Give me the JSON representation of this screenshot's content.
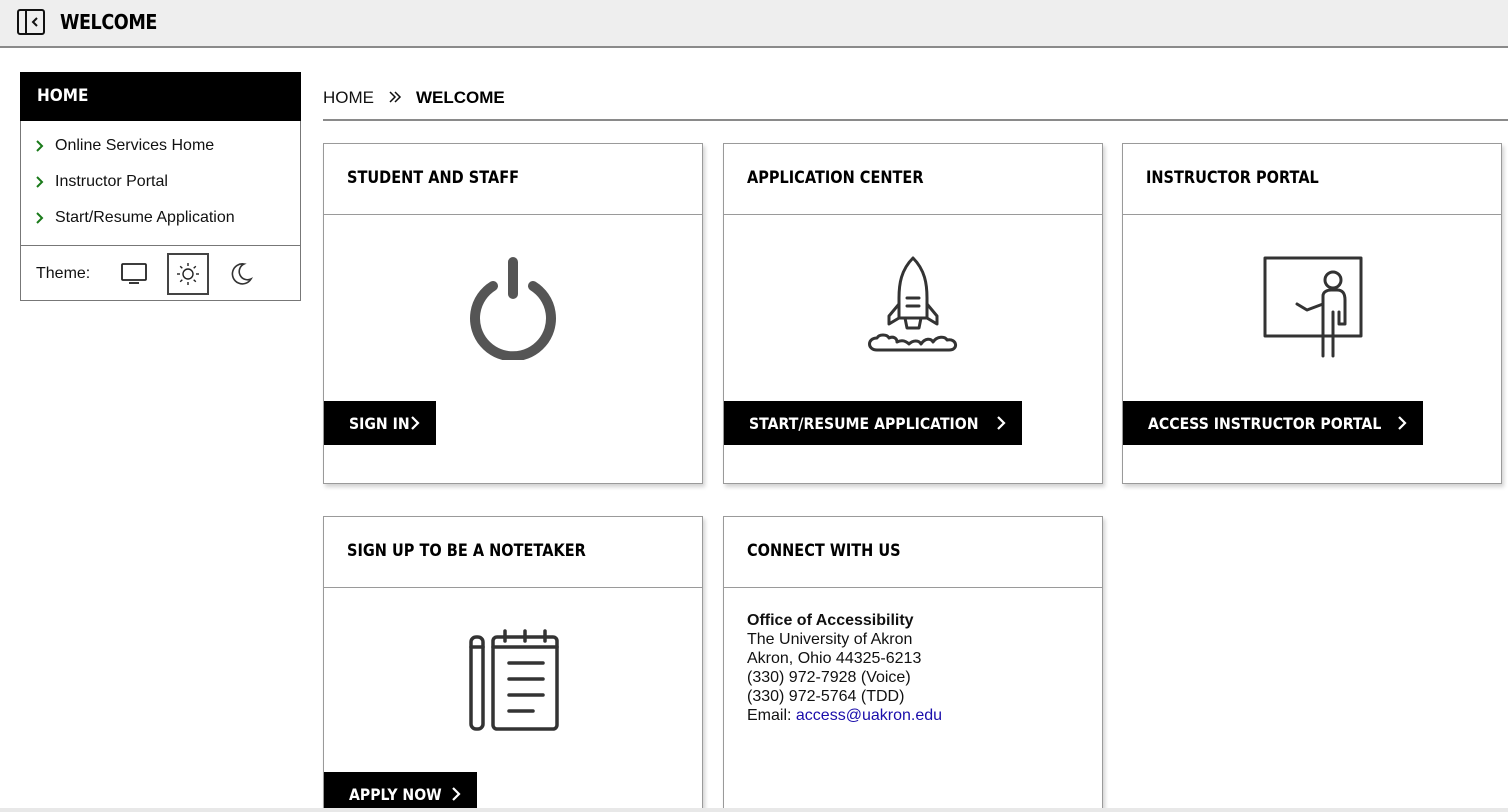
{
  "header": {
    "title": "WELCOME",
    "toggle_icon": "sidebar-collapse-icon"
  },
  "sidebar": {
    "heading": "HOME",
    "items": [
      {
        "label": "Online Services Home",
        "icon": "chevron-right-icon"
      },
      {
        "label": "Instructor Portal",
        "icon": "chevron-right-icon"
      },
      {
        "label": "Start/Resume Application",
        "icon": "chevron-right-icon"
      }
    ],
    "theme": {
      "label": "Theme:",
      "options": [
        "monitor-icon",
        "sun-icon",
        "moon-icon"
      ],
      "selected": "sun-icon"
    }
  },
  "breadcrumb": {
    "home": "HOME",
    "current": "WELCOME"
  },
  "cards": [
    {
      "title": "STUDENT AND STAFF",
      "icon": "power-icon",
      "action": "SIGN IN"
    },
    {
      "title": "APPLICATION CENTER",
      "icon": "rocket-icon",
      "action": "START/RESUME APPLICATION"
    },
    {
      "title": "INSTRUCTOR PORTAL",
      "icon": "teacher-board-icon",
      "action": "ACCESS INSTRUCTOR PORTAL"
    },
    {
      "title": "SIGN UP TO BE A NOTETAKER",
      "icon": "notepad-icon",
      "action": "APPLY NOW"
    },
    {
      "title": "CONNECT WITH US"
    }
  ],
  "contact": {
    "organization": "Office of Accessibility",
    "line1": "The University of Akron",
    "line2": "Akron, Ohio 44325-6213",
    "phone_voice": "(330) 972-7928 (Voice)",
    "phone_tdd": "(330) 972-5764 (TDD)",
    "email_label": "Email:",
    "email": "access@uakron.edu"
  },
  "colors": {
    "chevron_green": "#1a7a1a",
    "link_blue": "#1a0dab",
    "button_black": "#000000"
  }
}
